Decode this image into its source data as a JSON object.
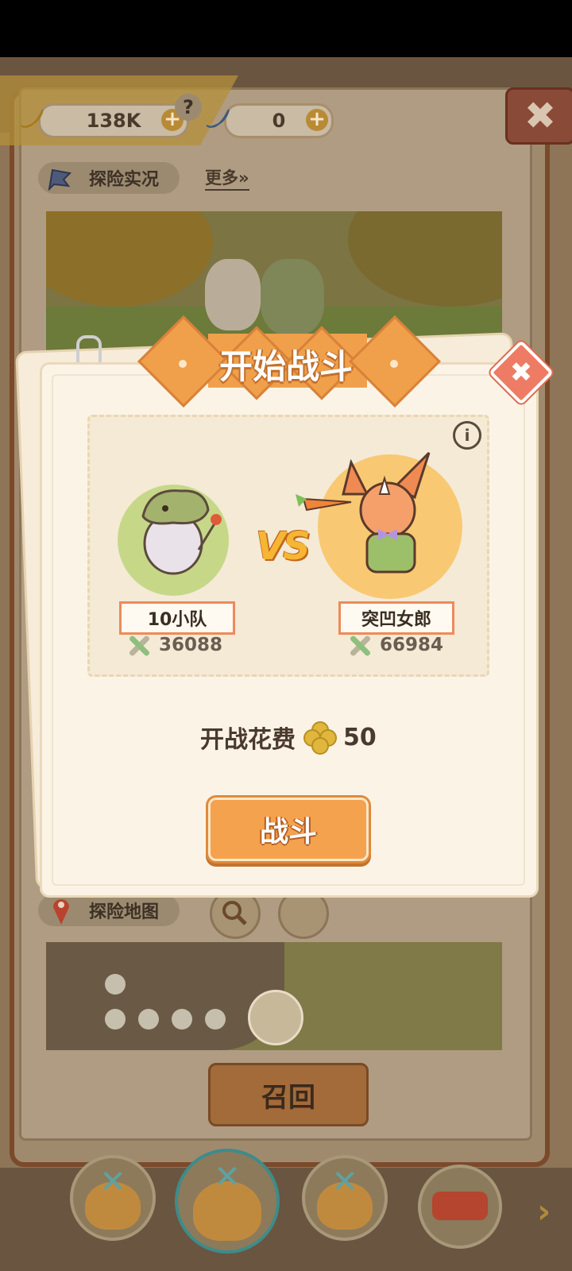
{
  "currency": {
    "banana": {
      "value": "138K",
      "icon": "banana-icon",
      "plus": "+"
    },
    "blue_banana": {
      "value": "0",
      "icon": "blue-banana-icon",
      "plus": "+"
    }
  },
  "header": {
    "help": "?",
    "close": "✖"
  },
  "live": {
    "label": "探险实况",
    "more": "更多»"
  },
  "map": {
    "label": "探险地图",
    "recall": "召回"
  },
  "dialog": {
    "title": "开始战斗",
    "close": "✖",
    "info": "i",
    "vs": "VS",
    "team_a": {
      "name": "10小队",
      "power": "36088"
    },
    "team_b": {
      "name": "突凹女郎",
      "power": "66984"
    },
    "cost_label": "开战花费",
    "cost_value": "50",
    "fight": "战斗"
  },
  "nav": {
    "next": "›"
  },
  "colors": {
    "accent": "#f4a24e",
    "title_orange": "#f0a04a",
    "close_red": "#ee7b64",
    "panel": "#fbf4e6"
  }
}
